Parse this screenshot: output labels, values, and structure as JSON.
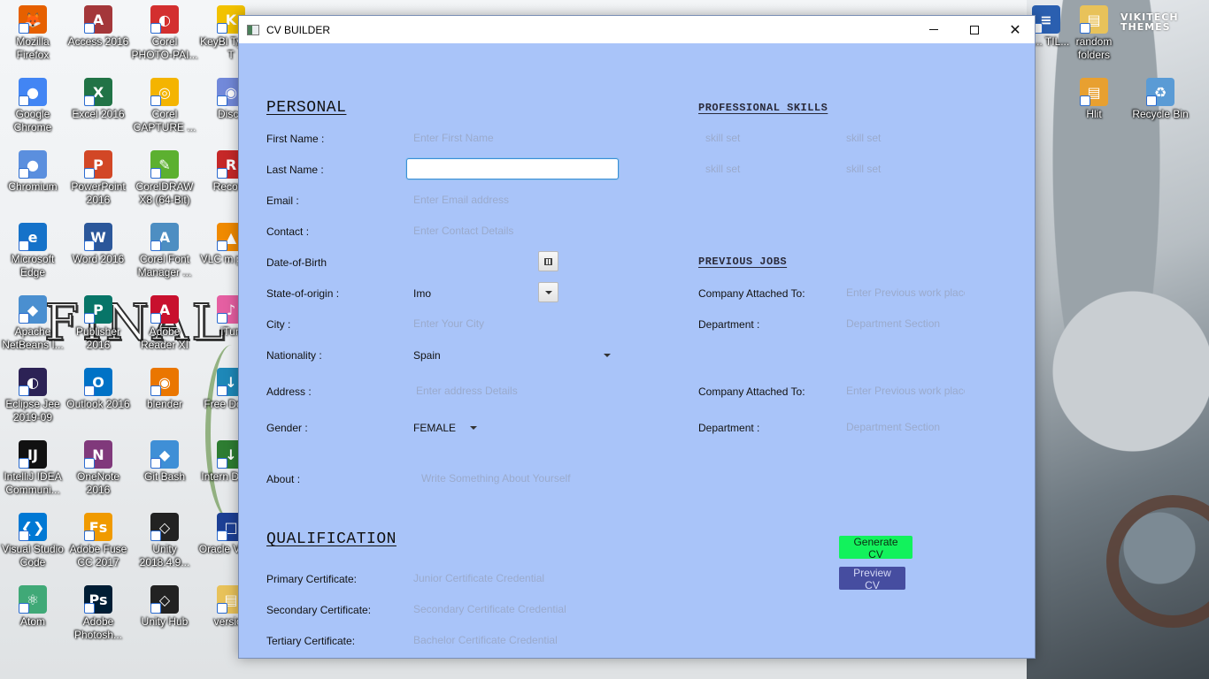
{
  "desktop": {
    "icons": [
      {
        "name": "firefox",
        "label": "Mozilla Firefox",
        "color": "#e66000",
        "glyph": "🦊"
      },
      {
        "name": "access",
        "label": "Access 2016",
        "color": "#a4373a",
        "glyph": "A"
      },
      {
        "name": "corel-photopaint",
        "label": "Corel PHOTO-PAI...",
        "color": "#d32f2f",
        "glyph": "◐"
      },
      {
        "name": "keyblaze",
        "label": "KeyBl Typing T",
        "color": "#f2c200",
        "glyph": "K"
      },
      {
        "name": "chrome",
        "label": "Google Chrome",
        "color": "#4285f4",
        "glyph": "●"
      },
      {
        "name": "excel",
        "label": "Excel 2016",
        "color": "#217346",
        "glyph": "X"
      },
      {
        "name": "corel-capture",
        "label": "Corel CAPTURE ...",
        "color": "#f4b400",
        "glyph": "◎"
      },
      {
        "name": "discord",
        "label": "Disco",
        "color": "#7289da",
        "glyph": "◉"
      },
      {
        "name": "chromium",
        "label": "Chromium",
        "color": "#5b8fde",
        "glyph": "●"
      },
      {
        "name": "powerpoint",
        "label": "PowerPoint 2016",
        "color": "#d24726",
        "glyph": "P"
      },
      {
        "name": "coreldraw",
        "label": "CorelDRAW X8 (64-Bit)",
        "color": "#5cb030",
        "glyph": "✎"
      },
      {
        "name": "recovery",
        "label": "Recove",
        "color": "#c62828",
        "glyph": "R"
      },
      {
        "name": "edge",
        "label": "Microsoft Edge",
        "color": "#1572c9",
        "glyph": "e"
      },
      {
        "name": "word",
        "label": "Word 2016",
        "color": "#2b579a",
        "glyph": "W"
      },
      {
        "name": "corel-font-manager",
        "label": "Corel Font Manager ...",
        "color": "#4d8ec2",
        "glyph": "A"
      },
      {
        "name": "vlc",
        "label": "VLC m playe",
        "color": "#f08a00",
        "glyph": "▲"
      },
      {
        "name": "netbeans",
        "label": "Apache NetBeans I...",
        "color": "#4a8fd0",
        "glyph": "◆"
      },
      {
        "name": "publisher",
        "label": "Publisher 2016",
        "color": "#077568",
        "glyph": "P"
      },
      {
        "name": "adobe-reader",
        "label": "Adobe Reader XI",
        "color": "#c8102e",
        "glyph": "A"
      },
      {
        "name": "itunes",
        "label": "iTun",
        "color": "#e55fa2",
        "glyph": "♪"
      },
      {
        "name": "eclipse",
        "label": "Eclipse Jee 2019-09",
        "color": "#2c2255",
        "glyph": "◐"
      },
      {
        "name": "outlook",
        "label": "Outlook 2016",
        "color": "#0072c6",
        "glyph": "O"
      },
      {
        "name": "blender",
        "label": "blender",
        "color": "#ea7600",
        "glyph": "◉"
      },
      {
        "name": "free-download",
        "label": "Free Downl",
        "color": "#1e88b8",
        "glyph": "↓"
      },
      {
        "name": "intellij",
        "label": "IntelliJ IDEA Communi...",
        "color": "#111111",
        "glyph": "IJ"
      },
      {
        "name": "onenote",
        "label": "OneNote 2016",
        "color": "#80397b",
        "glyph": "N"
      },
      {
        "name": "git-bash",
        "label": "Git Bash",
        "color": "#3f8fd6",
        "glyph": "◆"
      },
      {
        "name": "internet-download",
        "label": "Intern Downl",
        "color": "#2e7d32",
        "glyph": "↓"
      },
      {
        "name": "vscode",
        "label": "Visual Studio Code",
        "color": "#0078d4",
        "glyph": "❮❯"
      },
      {
        "name": "adobe-fuse",
        "label": "Adobe Fuse CC 2017",
        "color": "#f09a00",
        "glyph": "Fs"
      },
      {
        "name": "unity-2018",
        "label": "Unity 2018.4.9...",
        "color": "#222222",
        "glyph": "◇"
      },
      {
        "name": "oracle-virtualbox",
        "label": "Oracle Virtual",
        "color": "#1c3f94",
        "glyph": "□"
      },
      {
        "name": "atom",
        "label": "Atom",
        "color": "#40a977",
        "glyph": "⚛"
      },
      {
        "name": "photoshop",
        "label": "Adobe Photosh...",
        "color": "#001d34",
        "glyph": "Ps"
      },
      {
        "name": "unity-hub",
        "label": "Unity Hub",
        "color": "#222222",
        "glyph": "◇"
      },
      {
        "name": "version",
        "label": "version",
        "color": "#e8c25a",
        "glyph": "▤"
      },
      {
        "name": "html-file",
        "label": "RI... TIL...",
        "color": "#2a5fb0",
        "glyph": "≡"
      },
      {
        "name": "random-folders",
        "label": "random folders",
        "color": "#e8c25a",
        "glyph": "▤"
      },
      {
        "name": "hlit",
        "label": "Hlit",
        "color": "#e8a030",
        "glyph": "▤"
      },
      {
        "name": "recycle-bin",
        "label": "Recycle Bin",
        "color": "#5a9bd5",
        "glyph": "♻"
      }
    ],
    "brand": "VIKITECH THEMES",
    "wallpaper_logo": "FINAL FANTA"
  },
  "window": {
    "title": "CV BUILDER",
    "controls": {
      "minimize": "",
      "maximize": "",
      "close": "✕"
    }
  },
  "personal": {
    "title": "PERSONAL",
    "first_name": {
      "label": "First Name :",
      "value": "",
      "placeholder": "Enter First Name"
    },
    "last_name": {
      "label": "Last Name :",
      "value": "",
      "placeholder": ""
    },
    "email": {
      "label": "Email :",
      "value": "",
      "placeholder": "Enter Email address"
    },
    "contact": {
      "label": "Contact :",
      "value": "",
      "placeholder": "Enter Contact Details"
    },
    "dob": {
      "label": "Date-of-Birth",
      "value": ""
    },
    "state": {
      "label": "State-of-origin :",
      "value": "Imo"
    },
    "city": {
      "label": "City :",
      "value": "",
      "placeholder": "Enter Your City"
    },
    "nationality": {
      "label": "Nationality :",
      "value": "Spain"
    },
    "address": {
      "label": "Address :",
      "value": "",
      "placeholder": "Enter address Details"
    },
    "gender": {
      "label": "Gender :",
      "value": "FEMALE"
    },
    "about": {
      "label": "About :",
      "value": "",
      "placeholder": "Write Something About Yourself"
    }
  },
  "professional": {
    "title": "PROFESSIONAL SKILLS",
    "skills": [
      {
        "placeholder": "skill set"
      },
      {
        "placeholder": "skill set"
      },
      {
        "placeholder": "skill set"
      },
      {
        "placeholder": "skill set"
      }
    ]
  },
  "previous_jobs": {
    "title": "PREVIOUS JOBS",
    "jobs": [
      {
        "company_label": "Company Attached To:",
        "company_placeholder": "Enter Previous work place",
        "department_label": "Department :",
        "department_placeholder": "Department Section"
      },
      {
        "company_label": "Company Attached To:",
        "company_placeholder": "Enter Previous work place",
        "department_label": "Department :",
        "department_placeholder": "Department Section"
      }
    ]
  },
  "qualification": {
    "title": "QUALIFICATION",
    "primary": {
      "label": "Primary Certificate:",
      "placeholder": "Junior Certificate Credential"
    },
    "secondary": {
      "label": "Secondary Certificate:",
      "placeholder": "Secondary Certificate Credential"
    },
    "tertiary": {
      "label": "Tertiary Certificate:",
      "placeholder": "Bachelor Certificate Credential"
    }
  },
  "actions": {
    "generate": "Generate CV",
    "preview": "Preview CV"
  },
  "colors": {
    "window_bg": "#a9c4f9",
    "generate_bg": "#12f25c",
    "preview_bg": "#464da0",
    "focus_border": "#3b8ed7"
  }
}
